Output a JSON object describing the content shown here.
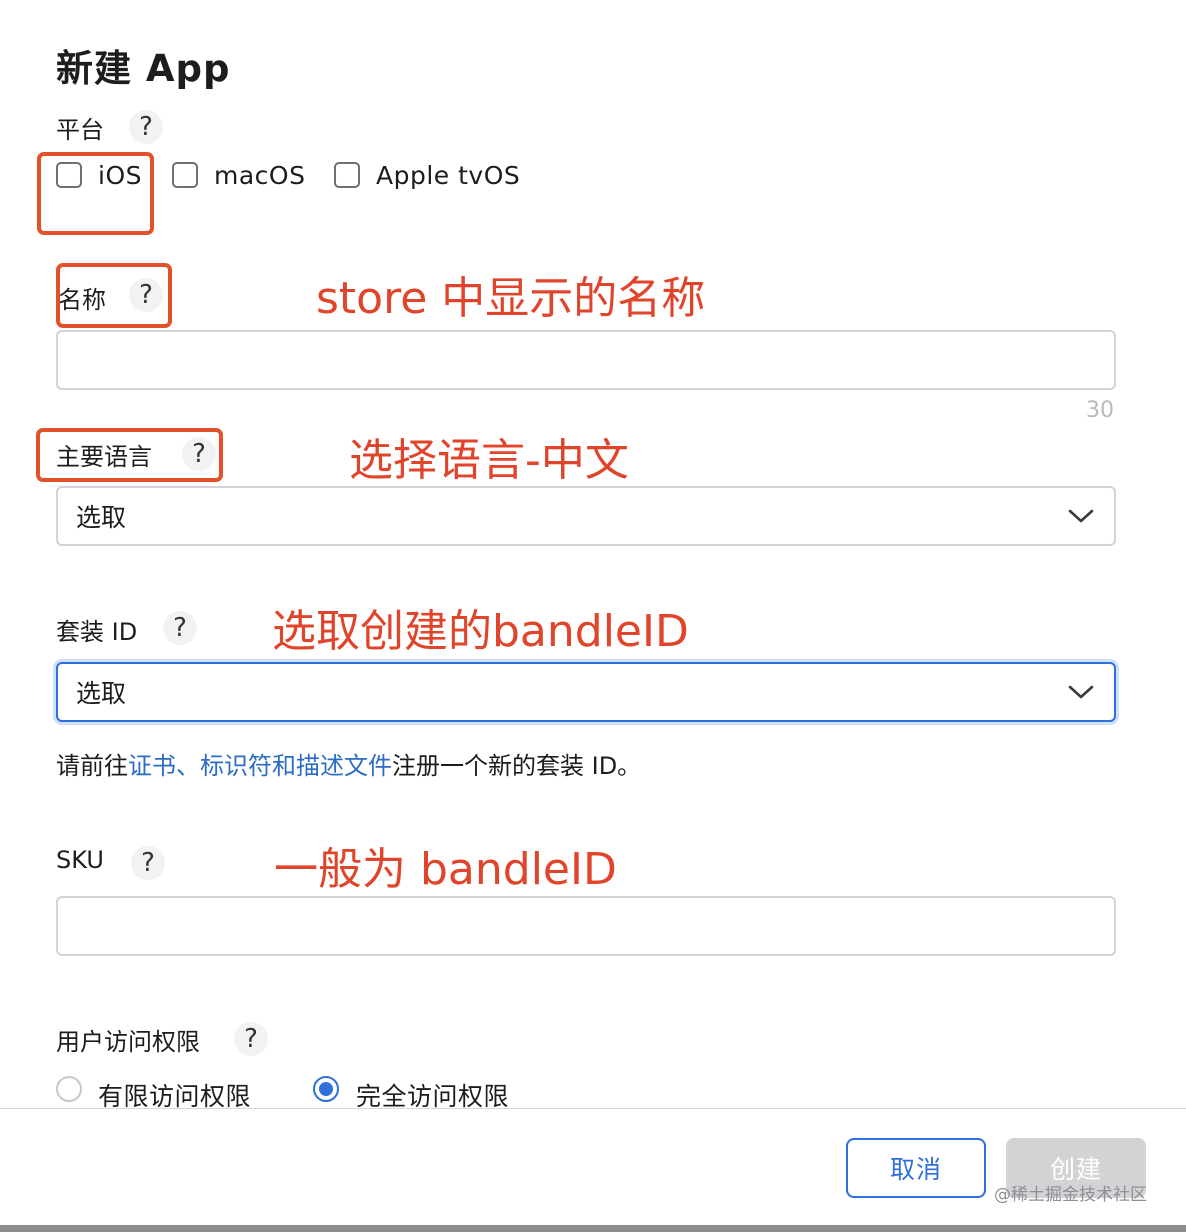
{
  "dialog": {
    "title": "新建 App"
  },
  "platform": {
    "label": "平台",
    "help": "?",
    "options": [
      {
        "label": "iOS",
        "checked": false
      },
      {
        "label": "macOS",
        "checked": false
      },
      {
        "label": "Apple tvOS",
        "checked": false
      }
    ]
  },
  "name": {
    "label": "名称",
    "help": "?",
    "value": "",
    "counter": "30"
  },
  "language": {
    "label": "主要语言",
    "help": "?",
    "value": "选取"
  },
  "bundle": {
    "label": "套装 ID",
    "help": "?",
    "value": "选取",
    "hint_prefix": "请前往",
    "hint_link": "证书、标识符和描述文件",
    "hint_suffix": "注册一个新的套装 ID。"
  },
  "sku": {
    "label": "SKU",
    "help": "?",
    "value": ""
  },
  "access": {
    "label": "用户访问权限",
    "help": "?",
    "options": [
      {
        "label": "有限访问权限",
        "selected": false
      },
      {
        "label": "完全访问权限",
        "selected": true
      }
    ]
  },
  "footer": {
    "cancel": "取消",
    "create": "创建"
  },
  "annotations": {
    "name": "store 中显示的名称",
    "language": "选择语言-中文",
    "bundle": "选取创建的bandleID",
    "sku": "一般为 bandleID"
  },
  "watermark": "@稀土掘金技术社区",
  "colors": {
    "accent": "#2f6fde",
    "annotation": "#e0442a",
    "link": "#2b6cc4"
  }
}
